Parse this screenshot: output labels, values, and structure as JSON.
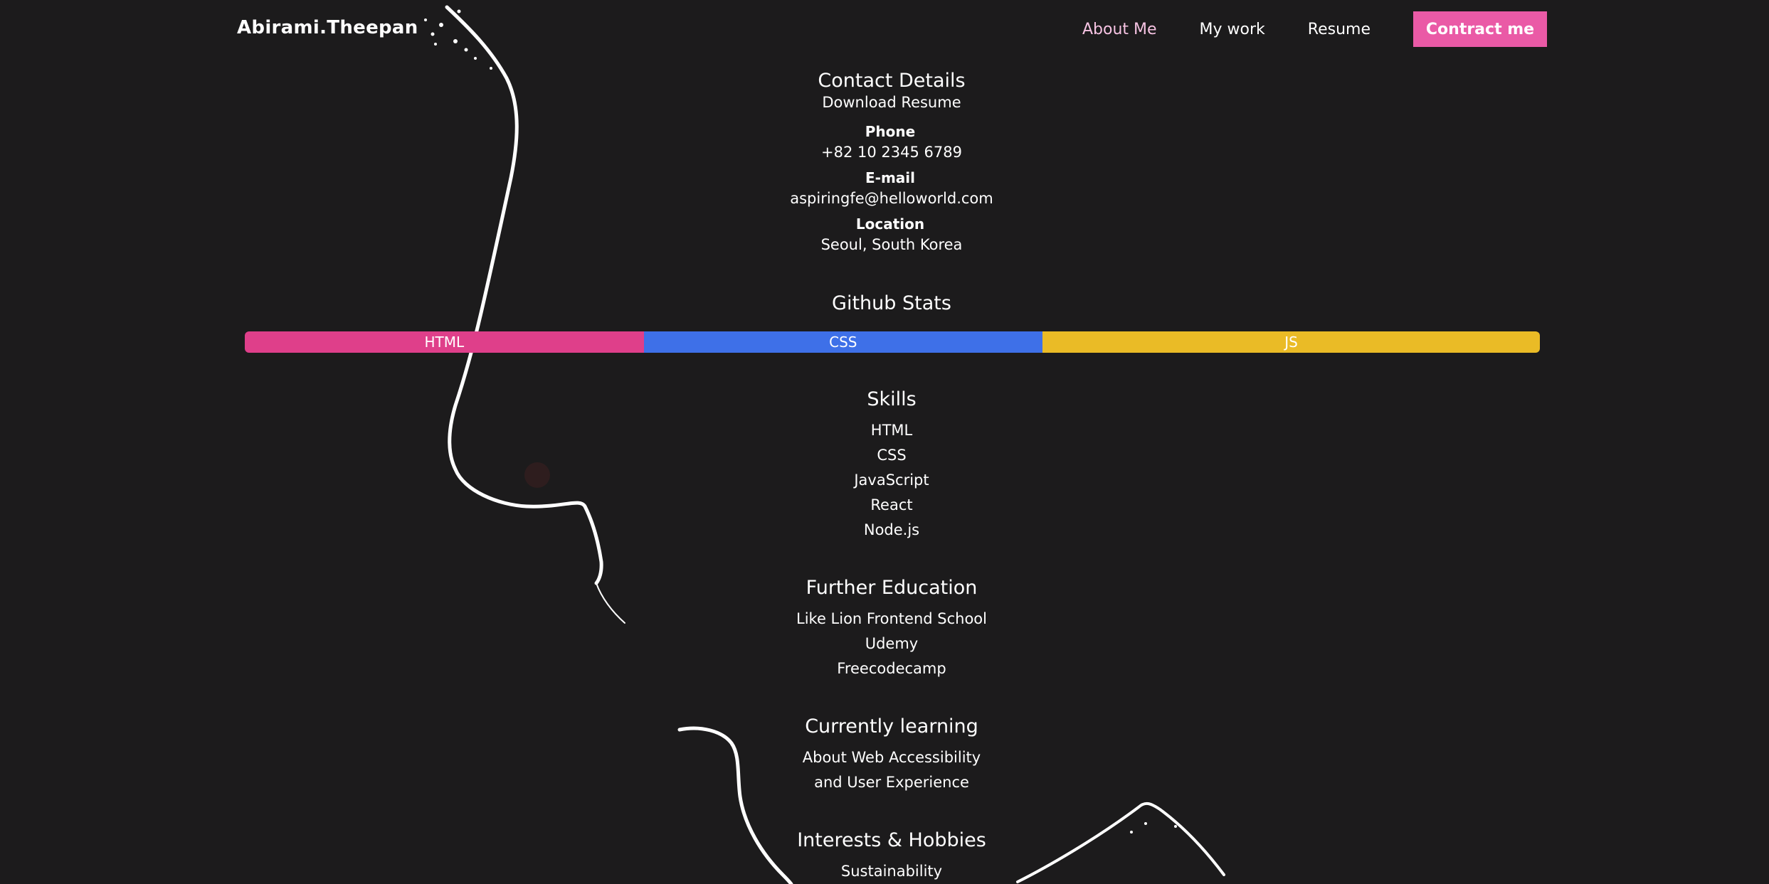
{
  "header": {
    "logo": "Abirami.Theepan",
    "nav": [
      {
        "label": "About Me",
        "active": true
      },
      {
        "label": "My work",
        "active": false
      },
      {
        "label": "Resume",
        "active": false
      }
    ],
    "cta_label": "Contract me"
  },
  "contact": {
    "title": "Contact Details",
    "download_label": "Download Resume",
    "phone_label": "Phone",
    "phone_value": "+82 10 2345 6789",
    "email_label": "E-mail",
    "email_value": "aspiringfe@helloworld.com",
    "location_label": "Location",
    "location_value": "Seoul, South Korea"
  },
  "github": {
    "title": "Github Stats",
    "languages": [
      {
        "name": "HTML",
        "share": 30.8,
        "color": "#df3f8a"
      },
      {
        "name": "CSS",
        "share": 30.8,
        "color": "#3e70e8"
      },
      {
        "name": "JS",
        "share": 38.4,
        "color": "#eabb26"
      }
    ]
  },
  "skills": {
    "title": "Skills",
    "items": [
      "HTML",
      "CSS",
      "JavaScript",
      "React",
      "Node.js"
    ]
  },
  "education": {
    "title": "Further Education",
    "items": [
      "Like Lion Frontend School",
      "Udemy",
      "Freecodecamp"
    ]
  },
  "learning": {
    "title": "Currently learning",
    "lines": [
      "About Web Accessibility",
      "and User Experience"
    ]
  },
  "hobbies": {
    "title": "Interests & Hobbies",
    "items": [
      "Sustainability"
    ]
  },
  "colors": {
    "background": "#1c1b1c",
    "accent": "#ea5aa6",
    "nav_active": "#f6c3e2"
  }
}
